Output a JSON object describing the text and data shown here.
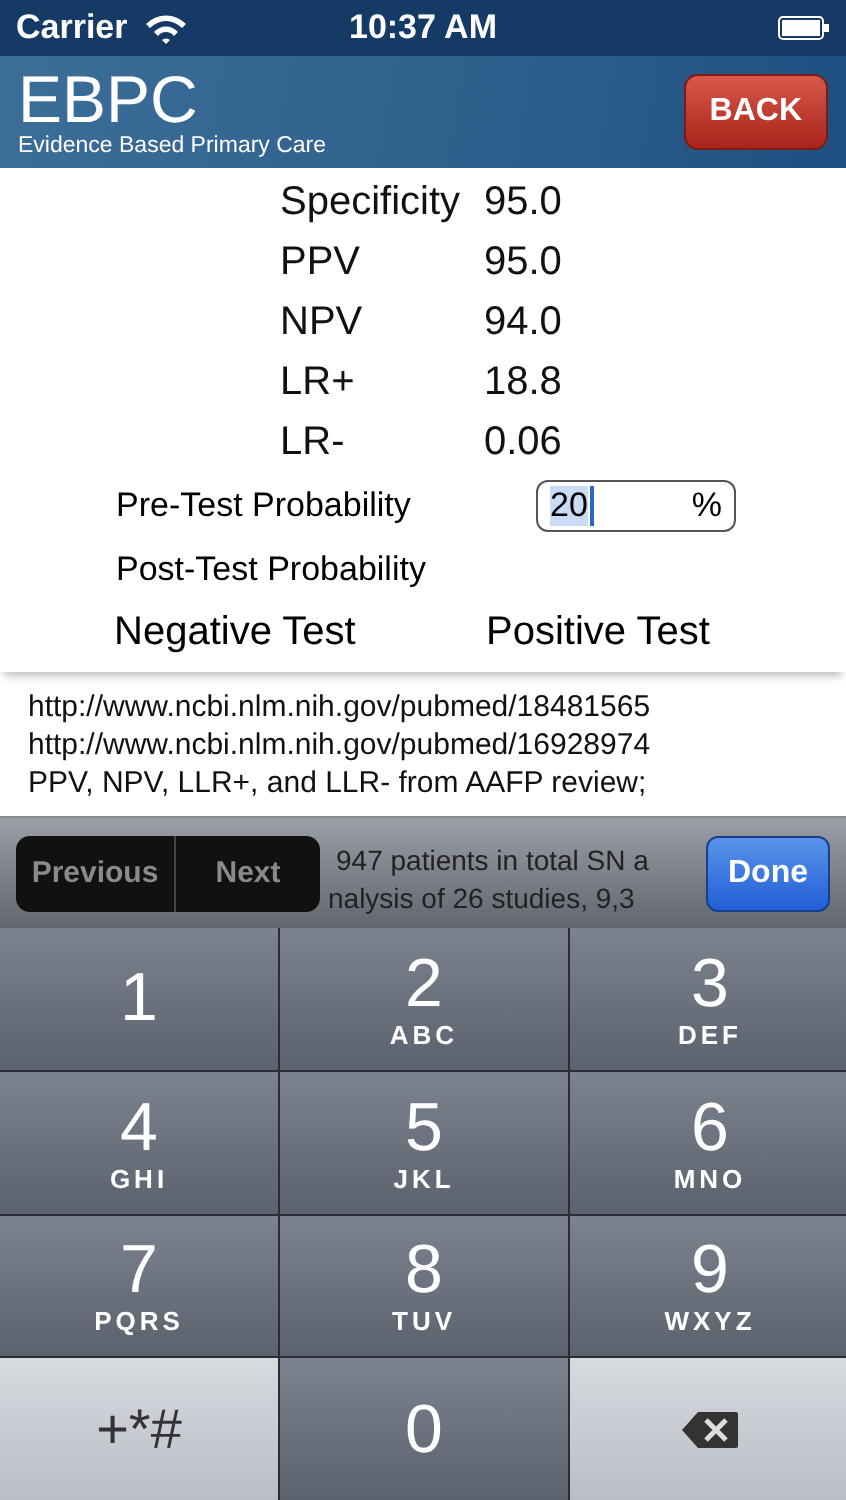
{
  "status_bar": {
    "carrier": "Carrier",
    "time": "10:37 AM"
  },
  "nav": {
    "title": "EBPC",
    "subtitle": "Evidence Based Primary Care",
    "back": "BACK"
  },
  "stats": [
    {
      "label": "Specificity",
      "value": "95.0"
    },
    {
      "label": "PPV",
      "value": "95.0"
    },
    {
      "label": "NPV",
      "value": "94.0"
    },
    {
      "label": "LR+",
      "value": "18.8"
    },
    {
      "label": "LR-",
      "value": "0.06"
    }
  ],
  "pre_test": {
    "label": "Pre-Test Probability",
    "value": "20",
    "unit": "%"
  },
  "post_test": {
    "label": "Post-Test Probability"
  },
  "results": [
    "Negative Test",
    "Positive Test"
  ],
  "notes": [
    "http://www.ncbi.nlm.nih.gov/pubmed/18481565",
    "http://www.ncbi.nlm.nih.gov/pubmed/16928974",
    "PPV, NPV, LLR+, and LLR- from AAFP review;"
  ],
  "toolbar": {
    "previous": "Previous",
    "next": "Next",
    "hidden_text": [
      "947 patients in total SN a",
      "nalysis of 26 studies, 9,3"
    ],
    "done": "Done"
  },
  "keys": [
    {
      "kind": "digit",
      "main": "1"
    },
    {
      "kind": "digit",
      "main": "2",
      "sub": "ABC"
    },
    {
      "kind": "digit",
      "main": "3",
      "sub": "DEF"
    },
    {
      "kind": "digit",
      "main": "4",
      "sub": "GHI"
    },
    {
      "kind": "digit",
      "main": "5",
      "sub": "JKL"
    },
    {
      "kind": "digit",
      "main": "6",
      "sub": "MNO"
    },
    {
      "kind": "digit",
      "main": "7",
      "sub": "PQRS"
    },
    {
      "kind": "digit",
      "main": "8",
      "sub": "TUV"
    },
    {
      "kind": "digit",
      "main": "9",
      "sub": "WXYZ"
    },
    {
      "kind": "symbols",
      "main": "+*#"
    },
    {
      "kind": "digit",
      "main": "0"
    },
    {
      "kind": "delete"
    }
  ]
}
